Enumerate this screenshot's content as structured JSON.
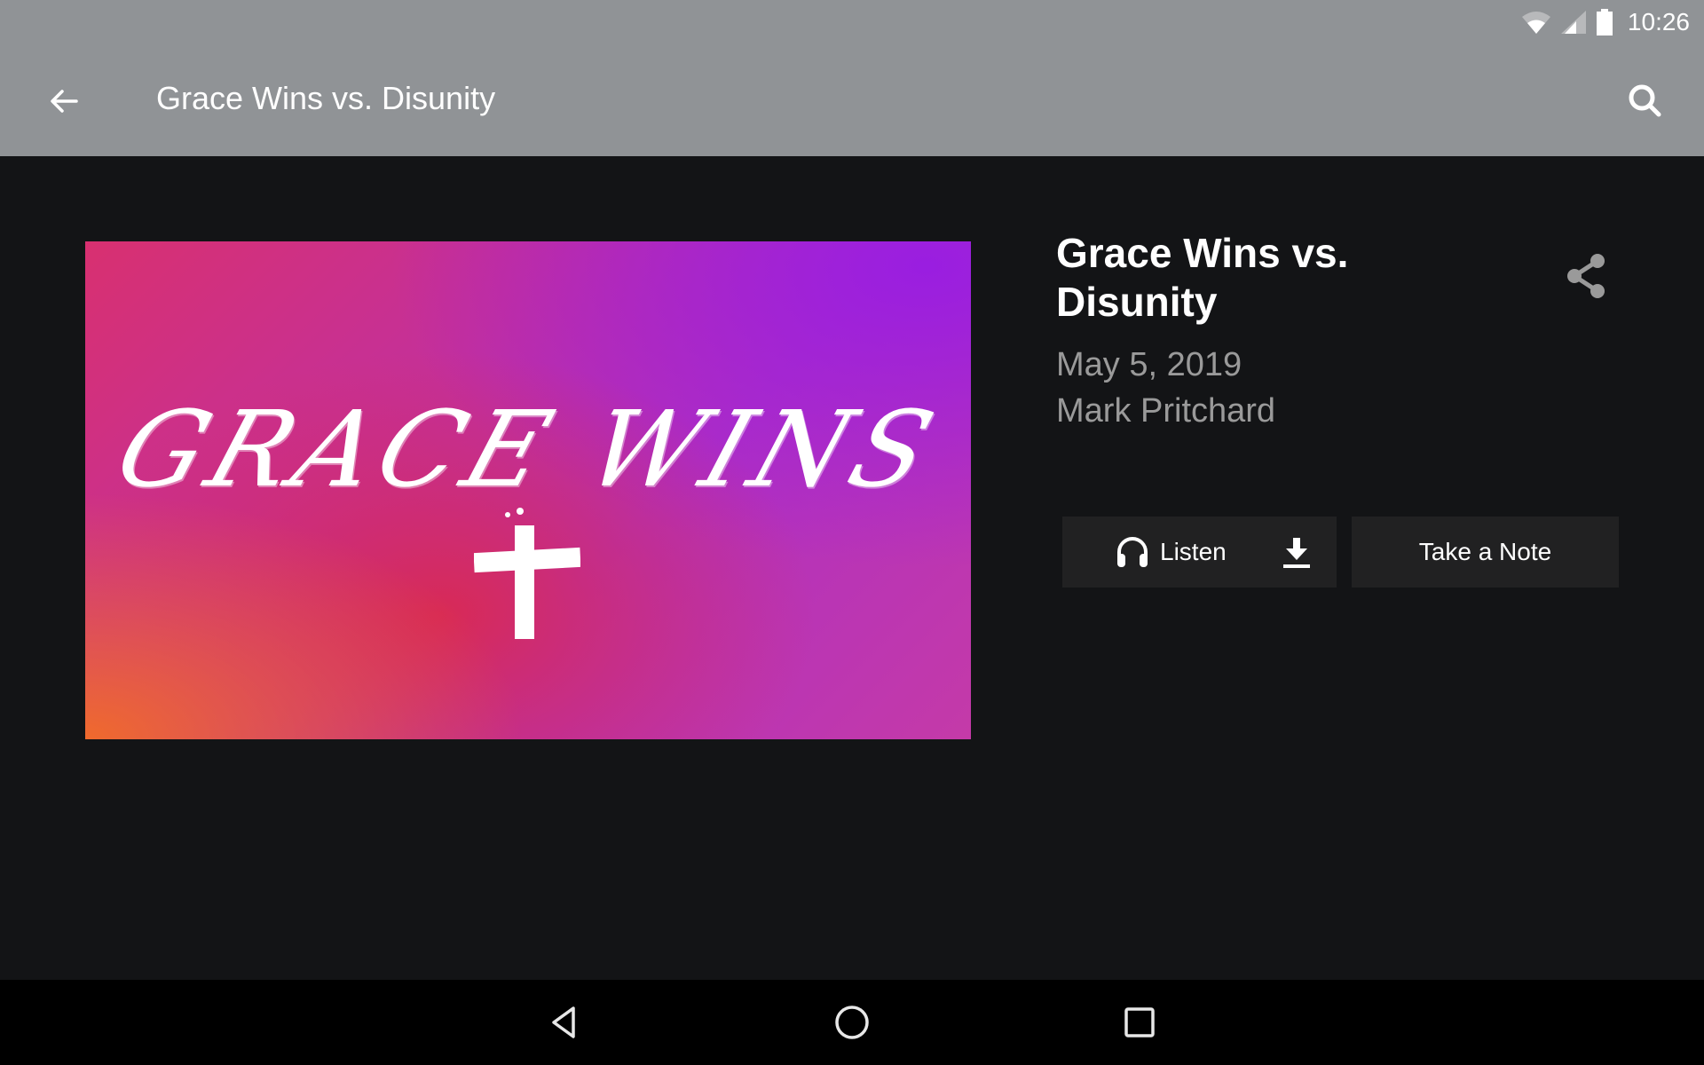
{
  "status_bar": {
    "time": "10:26",
    "icons": [
      "wifi-icon",
      "cell-signal-icon",
      "battery-icon"
    ]
  },
  "app_bar": {
    "title": "Grace Wins vs. Disunity",
    "back_icon": "arrow-left-icon",
    "search_icon": "search-icon"
  },
  "artwork": {
    "text": "GRACE WINS",
    "symbol": "cross"
  },
  "details": {
    "title": "Grace Wins vs. Disunity",
    "date": "May 5, 2019",
    "speaker": "Mark Pritchard",
    "share_icon": "share-icon"
  },
  "actions": {
    "listen_label": "Listen",
    "take_note_label": "Take a Note"
  },
  "nav_bar": {
    "buttons": [
      "back",
      "home",
      "recents"
    ]
  },
  "colors": {
    "app_bar": "#909396",
    "background": "#131416",
    "button_bg": "#212122",
    "secondary_text": "#9a9a9a"
  }
}
